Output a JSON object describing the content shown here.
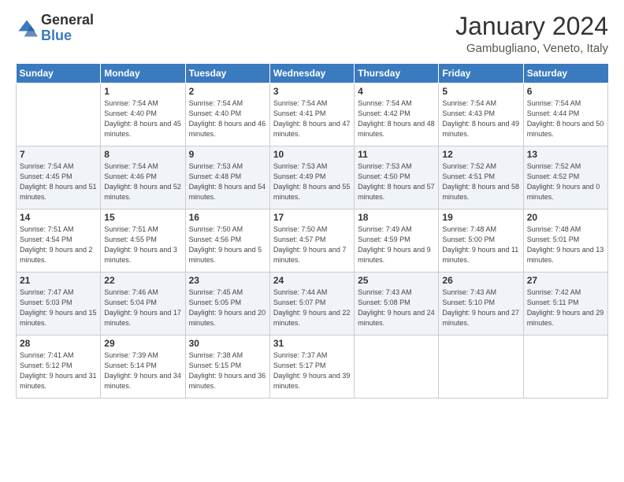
{
  "logo": {
    "general": "General",
    "blue": "Blue"
  },
  "title": "January 2024",
  "location": "Gambugliano, Veneto, Italy",
  "days_of_week": [
    "Sunday",
    "Monday",
    "Tuesday",
    "Wednesday",
    "Thursday",
    "Friday",
    "Saturday"
  ],
  "weeks": [
    [
      {
        "day": "",
        "sunrise": "",
        "sunset": "",
        "daylight": ""
      },
      {
        "day": "1",
        "sunrise": "Sunrise: 7:54 AM",
        "sunset": "Sunset: 4:40 PM",
        "daylight": "Daylight: 8 hours and 45 minutes."
      },
      {
        "day": "2",
        "sunrise": "Sunrise: 7:54 AM",
        "sunset": "Sunset: 4:40 PM",
        "daylight": "Daylight: 8 hours and 46 minutes."
      },
      {
        "day": "3",
        "sunrise": "Sunrise: 7:54 AM",
        "sunset": "Sunset: 4:41 PM",
        "daylight": "Daylight: 8 hours and 47 minutes."
      },
      {
        "day": "4",
        "sunrise": "Sunrise: 7:54 AM",
        "sunset": "Sunset: 4:42 PM",
        "daylight": "Daylight: 8 hours and 48 minutes."
      },
      {
        "day": "5",
        "sunrise": "Sunrise: 7:54 AM",
        "sunset": "Sunset: 4:43 PM",
        "daylight": "Daylight: 8 hours and 49 minutes."
      },
      {
        "day": "6",
        "sunrise": "Sunrise: 7:54 AM",
        "sunset": "Sunset: 4:44 PM",
        "daylight": "Daylight: 8 hours and 50 minutes."
      }
    ],
    [
      {
        "day": "7",
        "sunrise": "Sunrise: 7:54 AM",
        "sunset": "Sunset: 4:45 PM",
        "daylight": "Daylight: 8 hours and 51 minutes."
      },
      {
        "day": "8",
        "sunrise": "Sunrise: 7:54 AM",
        "sunset": "Sunset: 4:46 PM",
        "daylight": "Daylight: 8 hours and 52 minutes."
      },
      {
        "day": "9",
        "sunrise": "Sunrise: 7:53 AM",
        "sunset": "Sunset: 4:48 PM",
        "daylight": "Daylight: 8 hours and 54 minutes."
      },
      {
        "day": "10",
        "sunrise": "Sunrise: 7:53 AM",
        "sunset": "Sunset: 4:49 PM",
        "daylight": "Daylight: 8 hours and 55 minutes."
      },
      {
        "day": "11",
        "sunrise": "Sunrise: 7:53 AM",
        "sunset": "Sunset: 4:50 PM",
        "daylight": "Daylight: 8 hours and 57 minutes."
      },
      {
        "day": "12",
        "sunrise": "Sunrise: 7:52 AM",
        "sunset": "Sunset: 4:51 PM",
        "daylight": "Daylight: 8 hours and 58 minutes."
      },
      {
        "day": "13",
        "sunrise": "Sunrise: 7:52 AM",
        "sunset": "Sunset: 4:52 PM",
        "daylight": "Daylight: 9 hours and 0 minutes."
      }
    ],
    [
      {
        "day": "14",
        "sunrise": "Sunrise: 7:51 AM",
        "sunset": "Sunset: 4:54 PM",
        "daylight": "Daylight: 9 hours and 2 minutes."
      },
      {
        "day": "15",
        "sunrise": "Sunrise: 7:51 AM",
        "sunset": "Sunset: 4:55 PM",
        "daylight": "Daylight: 9 hours and 3 minutes."
      },
      {
        "day": "16",
        "sunrise": "Sunrise: 7:50 AM",
        "sunset": "Sunset: 4:56 PM",
        "daylight": "Daylight: 9 hours and 5 minutes."
      },
      {
        "day": "17",
        "sunrise": "Sunrise: 7:50 AM",
        "sunset": "Sunset: 4:57 PM",
        "daylight": "Daylight: 9 hours and 7 minutes."
      },
      {
        "day": "18",
        "sunrise": "Sunrise: 7:49 AM",
        "sunset": "Sunset: 4:59 PM",
        "daylight": "Daylight: 9 hours and 9 minutes."
      },
      {
        "day": "19",
        "sunrise": "Sunrise: 7:48 AM",
        "sunset": "Sunset: 5:00 PM",
        "daylight": "Daylight: 9 hours and 11 minutes."
      },
      {
        "day": "20",
        "sunrise": "Sunrise: 7:48 AM",
        "sunset": "Sunset: 5:01 PM",
        "daylight": "Daylight: 9 hours and 13 minutes."
      }
    ],
    [
      {
        "day": "21",
        "sunrise": "Sunrise: 7:47 AM",
        "sunset": "Sunset: 5:03 PM",
        "daylight": "Daylight: 9 hours and 15 minutes."
      },
      {
        "day": "22",
        "sunrise": "Sunrise: 7:46 AM",
        "sunset": "Sunset: 5:04 PM",
        "daylight": "Daylight: 9 hours and 17 minutes."
      },
      {
        "day": "23",
        "sunrise": "Sunrise: 7:45 AM",
        "sunset": "Sunset: 5:05 PM",
        "daylight": "Daylight: 9 hours and 20 minutes."
      },
      {
        "day": "24",
        "sunrise": "Sunrise: 7:44 AM",
        "sunset": "Sunset: 5:07 PM",
        "daylight": "Daylight: 9 hours and 22 minutes."
      },
      {
        "day": "25",
        "sunrise": "Sunrise: 7:43 AM",
        "sunset": "Sunset: 5:08 PM",
        "daylight": "Daylight: 9 hours and 24 minutes."
      },
      {
        "day": "26",
        "sunrise": "Sunrise: 7:43 AM",
        "sunset": "Sunset: 5:10 PM",
        "daylight": "Daylight: 9 hours and 27 minutes."
      },
      {
        "day": "27",
        "sunrise": "Sunrise: 7:42 AM",
        "sunset": "Sunset: 5:11 PM",
        "daylight": "Daylight: 9 hours and 29 minutes."
      }
    ],
    [
      {
        "day": "28",
        "sunrise": "Sunrise: 7:41 AM",
        "sunset": "Sunset: 5:12 PM",
        "daylight": "Daylight: 9 hours and 31 minutes."
      },
      {
        "day": "29",
        "sunrise": "Sunrise: 7:39 AM",
        "sunset": "Sunset: 5:14 PM",
        "daylight": "Daylight: 9 hours and 34 minutes."
      },
      {
        "day": "30",
        "sunrise": "Sunrise: 7:38 AM",
        "sunset": "Sunset: 5:15 PM",
        "daylight": "Daylight: 9 hours and 36 minutes."
      },
      {
        "day": "31",
        "sunrise": "Sunrise: 7:37 AM",
        "sunset": "Sunset: 5:17 PM",
        "daylight": "Daylight: 9 hours and 39 minutes."
      },
      {
        "day": "",
        "sunrise": "",
        "sunset": "",
        "daylight": ""
      },
      {
        "day": "",
        "sunrise": "",
        "sunset": "",
        "daylight": ""
      },
      {
        "day": "",
        "sunrise": "",
        "sunset": "",
        "daylight": ""
      }
    ]
  ]
}
